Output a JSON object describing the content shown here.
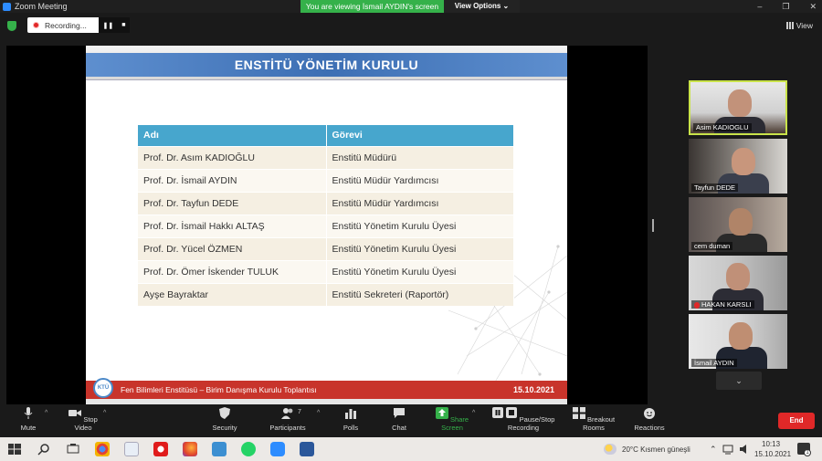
{
  "window": {
    "title": "Zoom Meeting",
    "banner": "You are viewing İsmail AYDIN's screen",
    "view_options": "View Options ⌄",
    "controls": [
      "–",
      "❐",
      "✕"
    ]
  },
  "topbar": {
    "recording_label": "Recording...",
    "pause_glyph": "❚❚",
    "stop_glyph": "■",
    "view_label": "View"
  },
  "slide": {
    "title": "ENSTİTÜ YÖNETİM KURULU",
    "table": {
      "headers": [
        "Adı",
        "Görevi"
      ],
      "rows": [
        [
          "Prof. Dr. Asım KADIOĞLU",
          "Enstitü Müdürü"
        ],
        [
          "Prof. Dr. İsmail AYDIN",
          "Enstitü Müdür Yardımcısı"
        ],
        [
          "Prof. Dr. Tayfun DEDE",
          "Enstitü Müdür Yardımcısı"
        ],
        [
          "Prof. Dr. İsmail Hakkı ALTAŞ",
          "Enstitü Yönetim Kurulu Üyesi"
        ],
        [
          "Prof. Dr. Yücel ÖZMEN",
          "Enstitü Yönetim Kurulu Üyesi"
        ],
        [
          "Prof. Dr. Ömer İskender TULUK",
          "Enstitü Yönetim Kurulu Üyesi"
        ],
        [
          "Ayşe Bayraktar",
          "Enstitü Sekreteri (Raportör)"
        ]
      ]
    },
    "footer_text": "Fen Bilimleri Enstitüsü – Birim Danışma Kurulu Toplantısı",
    "footer_date": "15.10.2021"
  },
  "participants": [
    {
      "name": "Asim KADIOGLU",
      "active": true,
      "muted": false
    },
    {
      "name": "Tayfun DEDE",
      "active": false,
      "muted": false
    },
    {
      "name": "cem duman",
      "active": false,
      "muted": false
    },
    {
      "name": "HAKAN KARSLI",
      "active": false,
      "muted": true
    },
    {
      "name": "İsmail AYDIN",
      "active": false,
      "muted": false
    }
  ],
  "gallery_down": "⌄",
  "toolbar": {
    "mute": "Mute",
    "stop_video": "Stop Video",
    "security": "Security",
    "participants": "Participants",
    "participants_count": "7",
    "polls": "Polls",
    "chat": "Chat",
    "share_screen": "Share Screen",
    "pause_recording": "Pause/Stop Recording",
    "breakout_rooms": "Breakout Rooms",
    "reactions": "Reactions",
    "end": "End"
  },
  "taskbar": {
    "weather": "20°C  Kısmen güneşli",
    "time": "10:13",
    "date": "15.10.2021",
    "notification_count": "1"
  },
  "colors": {
    "banner_green": "#35b14a",
    "table_header": "#47a6cd",
    "footer_red": "#c8342b",
    "end_red": "#e02828",
    "active_speaker": "#c9e34a"
  }
}
